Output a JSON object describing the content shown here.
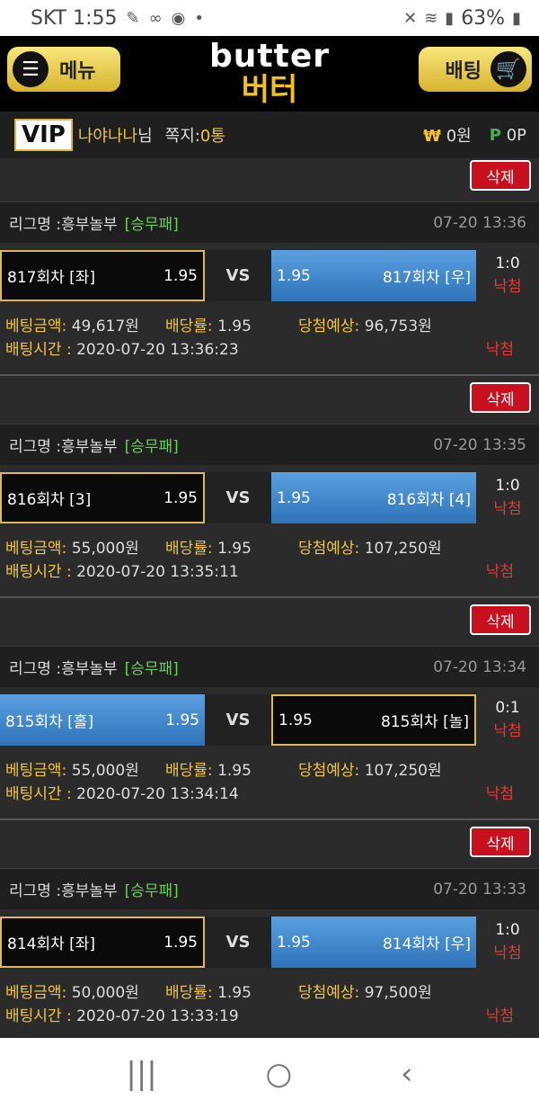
{
  "status": {
    "carrier_time": "SKT 1:55",
    "battery": "63%",
    "dot": "•"
  },
  "header": {
    "menu_label": "메뉴",
    "logo_en": "butter",
    "logo_ko": "버터",
    "bet_label": "배팅"
  },
  "user": {
    "vip": "VIP",
    "nickname": "나야나나",
    "suffix": "님",
    "message_label": "쪽지:",
    "message_count": "0통",
    "won_symbol": "₩",
    "money": "0원",
    "point_symbol": "P",
    "point": "0P"
  },
  "labels": {
    "delete": "삭제",
    "league_prefix": "리그명 : ",
    "vs": "VS",
    "amount": "베팅금액:",
    "rate": "배당률:",
    "expected": "당첨예상:",
    "bet_time": "배팅시간 : "
  },
  "bets": [
    {
      "league": "흥부놀부",
      "type": "[승무패]",
      "date": "07-20 13:36",
      "home": "817회차 [좌]",
      "home_odds": "1.95",
      "away": "817회차 [우]",
      "away_odds": "1.95",
      "score": "1:0",
      "result": "낙첨",
      "amount": "49,617원",
      "rate": "1.95",
      "expected": "96,753원",
      "time": "2020-07-20 13:36:23",
      "final": "낙첨"
    },
    {
      "league": "흥부놀부",
      "type": "[승무패]",
      "date": "07-20 13:35",
      "home": "816회차 [3]",
      "home_odds": "1.95",
      "away": "816회차 [4]",
      "away_odds": "1.95",
      "score": "1:0",
      "result": "낙첨",
      "amount": "55,000원",
      "rate": "1.95",
      "expected": "107,250원",
      "time": "2020-07-20 13:35:11",
      "final": "낙첨"
    },
    {
      "league": "흥부놀부",
      "type": "[승무패]",
      "date": "07-20 13:34",
      "home": "815회차 [홀]",
      "home_odds": "1.95",
      "away": "815회차 [놀]",
      "away_odds": "1.95",
      "score": "0:1",
      "result": "낙첨",
      "amount": "55,000원",
      "rate": "1.95",
      "expected": "107,250원",
      "time": "2020-07-20 13:34:14",
      "final": "낙첨"
    },
    {
      "league": "흥부놀부",
      "type": "[승무패]",
      "date": "07-20 13:33",
      "home": "814회차 [좌]",
      "home_odds": "1.95",
      "away": "814회차 [우]",
      "away_odds": "1.95",
      "score": "1:0",
      "result": "낙첨",
      "amount": "50,000원",
      "rate": "1.95",
      "expected": "97,500원",
      "time": "2020-07-20 13:33:19",
      "final": "낙첨"
    }
  ],
  "nav": {
    "recent": "|||",
    "home": "○",
    "back": "‹"
  }
}
